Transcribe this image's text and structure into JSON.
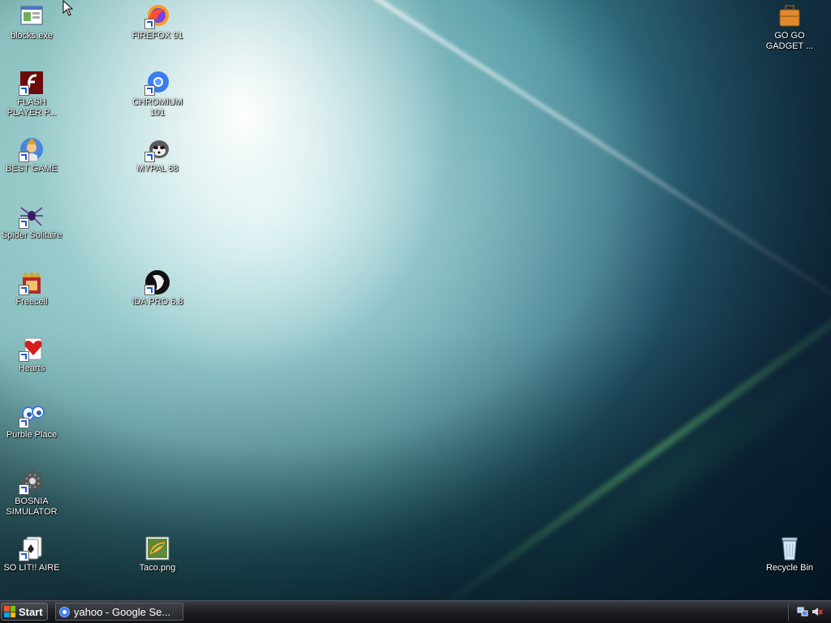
{
  "desktop": {
    "icons": [
      {
        "label": "blocks.exe",
        "icon": "blocks-window-icon"
      },
      {
        "label": "FIREFOX 91",
        "icon": "firefox-icon"
      },
      {
        "label": "GO GO GADGET ...",
        "icon": "briefcase-icon"
      },
      {
        "label": "FLASH PLAYER P...",
        "icon": "flash-icon"
      },
      {
        "label": "CHROMIUM 101",
        "icon": "chromium-icon"
      },
      {
        "label": "BEST GAME",
        "icon": "wizard-icon"
      },
      {
        "label": "MYPAL 68",
        "icon": "raccoon-icon"
      },
      {
        "label": "Spider Solitaire",
        "icon": "spider-icon"
      },
      {
        "label": "Freecell",
        "icon": "freecell-king-icon"
      },
      {
        "label": "IDA PRO 6.8",
        "icon": "ida-icon"
      },
      {
        "label": "Hearts",
        "icon": "hearts-icon"
      },
      {
        "label": "Purble Place",
        "icon": "purble-eye-icon"
      },
      {
        "label": "BOSNIA SIMULATOR",
        "icon": "gear-icon"
      },
      {
        "label": "SO LIT!! AIRE",
        "icon": "cards-icon"
      },
      {
        "label": "Taco.png",
        "icon": "taco-image-icon"
      },
      {
        "label": "Recycle Bin",
        "icon": "recycle-bin-icon"
      }
    ]
  },
  "taskbar": {
    "start_label": "Start",
    "task_label": "yahoo - Google Se...",
    "tray_icons": [
      "network-icon",
      "volume-muted-icon"
    ]
  },
  "colors": {
    "start_logo": [
      "#f35325",
      "#81bc06",
      "#05a6f0",
      "#ffba08"
    ],
    "shortcut_arrow": "#1d5ccf"
  }
}
